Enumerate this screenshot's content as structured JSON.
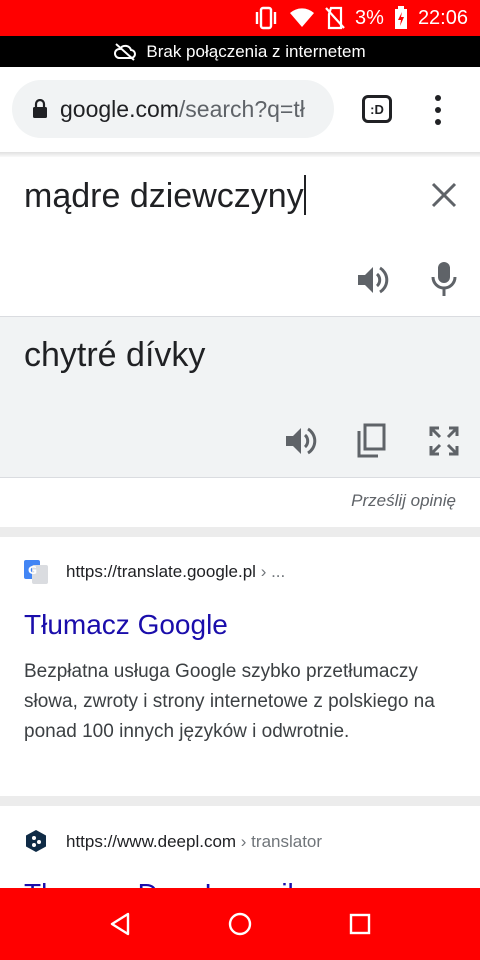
{
  "status_bar": {
    "battery": "3%",
    "time": "22:06"
  },
  "offline_banner": {
    "text": "Brak połączenia z internetem"
  },
  "browser": {
    "url_domain": "google.com",
    "url_rest": "/search?q=tł",
    "tab_label": ":D"
  },
  "translator": {
    "source_text": "mądre dziewczyny",
    "target_text": "chytré dívky",
    "feedback": "Prześlij opinię"
  },
  "results": [
    {
      "url": "https://translate.google.pl",
      "crumb": " › ...",
      "title": "Tłumacz Google",
      "snippet": "Bezpłatna usługa Google szybko przetłumaczy słowa, zwroty i strony internetowe z polskiego na ponad 100 innych języków i odwrotnie."
    },
    {
      "url": "https://www.deepl.com",
      "crumb": " › translator",
      "title": "Tłumacz DeepL – najlepszy"
    }
  ],
  "colors": {
    "status_bar": "#ff0000",
    "nav_bar": "#ff0000",
    "link": "#1a0dab",
    "translate_panel": "#f1f3f4"
  },
  "icons": [
    "vibrate-icon",
    "wifi-icon",
    "no-sim-icon",
    "battery-charging-icon",
    "cloud-off-icon",
    "lock-icon",
    "close-icon",
    "speaker-icon",
    "mic-icon",
    "copy-icon",
    "fullscreen-icon",
    "back-icon",
    "home-icon",
    "recents-icon"
  ]
}
